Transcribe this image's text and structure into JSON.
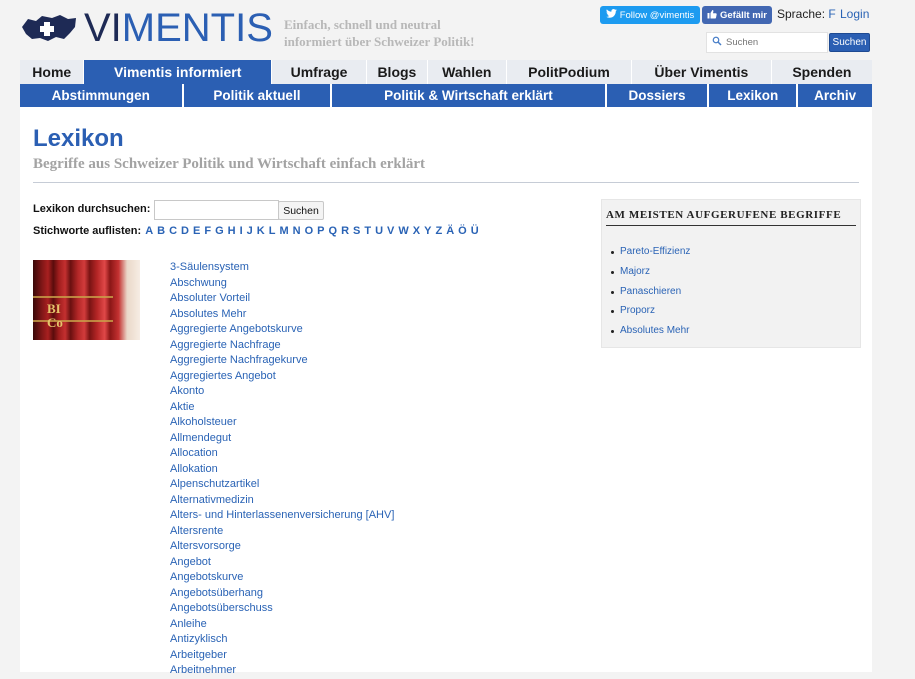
{
  "header": {
    "logo_vi": "VI",
    "logo_mentis": "MENTIS",
    "tagline_line1": "Einfach, schnell und neutral",
    "tagline_line2": "informiert über Schweizer Politik!",
    "twitter_label": "Follow @vimentis",
    "facebook_label": "Gefällt mir",
    "language_label": "Sprache:",
    "language_value": "F",
    "login_label": "Login",
    "search_placeholder": "Suchen",
    "search_button": "Suchen"
  },
  "nav_main": [
    {
      "label": "Home",
      "active": false
    },
    {
      "label": "Vimentis informiert",
      "active": true
    },
    {
      "label": "Umfrage",
      "active": false
    },
    {
      "label": "Blogs",
      "active": false
    },
    {
      "label": "Wahlen",
      "active": false
    },
    {
      "label": "PolitPodium",
      "active": false
    },
    {
      "label": "Über Vimentis",
      "active": false
    },
    {
      "label": "Spenden",
      "active": false
    }
  ],
  "nav_sub": [
    {
      "label": "Abstimmungen"
    },
    {
      "label": "Politik aktuell"
    },
    {
      "label": "Politik & Wirtschaft erklärt"
    },
    {
      "label": "Dossiers"
    },
    {
      "label": "Lexikon"
    },
    {
      "label": "Archiv"
    }
  ],
  "page": {
    "title": "Lexikon",
    "subtitle": "Begriffe aus Schweizer Politik und Wirtschaft einfach erklärt",
    "search_label": "Lexikon durchsuchen:",
    "search_value": "",
    "search_button": "Suchen",
    "keywords_label": "Stichworte auflisten:",
    "letters": [
      "A",
      "B",
      "C",
      "D",
      "E",
      "F",
      "G",
      "H",
      "I",
      "J",
      "K",
      "L",
      "M",
      "N",
      "O",
      "P",
      "Q",
      "R",
      "S",
      "T",
      "U",
      "V",
      "W",
      "X",
      "Y",
      "Z",
      "Ä",
      "Ö",
      "Ü"
    ],
    "book_text": "BI\nCo"
  },
  "terms": [
    "3-Säulensystem",
    "Abschwung",
    "Absoluter Vorteil",
    "Absolutes Mehr",
    "Aggregierte Angebotskurve",
    "Aggregierte Nachfrage",
    "Aggregierte Nachfragekurve",
    "Aggregiertes Angebot",
    "Akonto",
    "Aktie",
    "Alkoholsteuer",
    "Allmendegut",
    "Allocation",
    "Allokation",
    "Alpenschutzartikel",
    "Alternativmedizin",
    "Alters- und Hinterlassenenversicherung [AHV]",
    "Altersrente",
    "Altersvorsorge",
    "Angebot",
    "Angebotskurve",
    "Angebotsüberhang",
    "Angebotsüberschuss",
    "Anleihe",
    "Antizyklisch",
    "Arbeitgeber",
    "Arbeitnehmer"
  ],
  "popular": {
    "title": "AM MEISTEN AUFGERUFENE BEGRIFFE",
    "items": [
      "Pareto-Effizienz",
      "Majorz",
      "Panaschieren",
      "Proporz",
      "Absolutes Mehr"
    ]
  },
  "colors": {
    "brand_blue": "#2b5fb3",
    "link_blue": "#2a63b5",
    "twitter": "#1d9bf0",
    "facebook": "#4267b2"
  }
}
